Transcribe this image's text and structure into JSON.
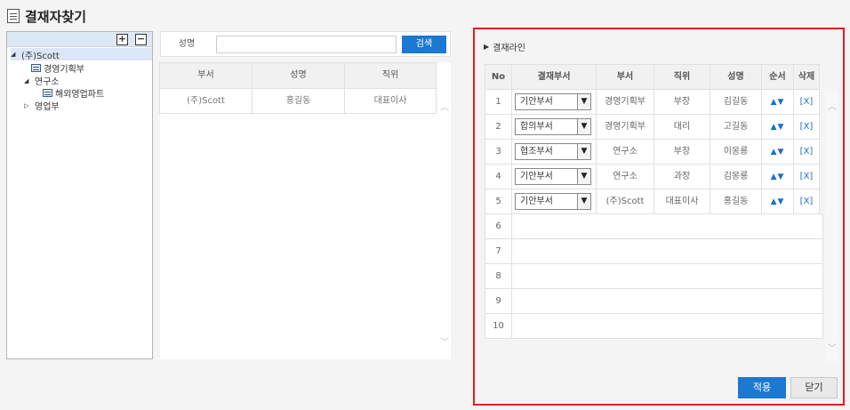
{
  "page_title": "결재자찾기",
  "tree": {
    "nodes": [
      {
        "label": "(주)Scott",
        "arrow": "◢"
      },
      {
        "label": "경영기획부"
      },
      {
        "label": "연구소",
        "arrow": "◢"
      },
      {
        "label": "해외영업파트"
      },
      {
        "label": "영업부",
        "arrow": "▷"
      }
    ]
  },
  "search": {
    "label": "성명",
    "value": "",
    "placeholder": "",
    "button": "검색"
  },
  "employees": {
    "columns": [
      "부서",
      "성명",
      "직위"
    ],
    "rows": [
      {
        "dept": "(주)Scott",
        "name": "홍길동",
        "position": "대표이사"
      }
    ]
  },
  "approval_line": {
    "title": "결재라인",
    "columns": [
      "No",
      "결재부서",
      "부서",
      "직위",
      "성명",
      "순서",
      "삭제"
    ],
    "rows": [
      {
        "no": "1",
        "type": "기안부서",
        "dept": "경영기획부",
        "position": "부장",
        "name": "김길동",
        "order": "▲▼",
        "delete": "[X]"
      },
      {
        "no": "2",
        "type": "합의부서",
        "dept": "경영기획부",
        "position": "대리",
        "name": "고길동",
        "order": "▲▼",
        "delete": "[X]"
      },
      {
        "no": "3",
        "type": "협조부서",
        "dept": "연구소",
        "position": "부장",
        "name": "이몽룡",
        "order": "▲▼",
        "delete": "[X]"
      },
      {
        "no": "4",
        "type": "기안부서",
        "dept": "연구소",
        "position": "과장",
        "name": "김몽룡",
        "order": "▲▼",
        "delete": "[X]"
      },
      {
        "no": "5",
        "type": "기안부서",
        "dept": "(주)Scott",
        "position": "대표이사",
        "name": "홍길동",
        "order": "▲▼",
        "delete": "[X]"
      }
    ],
    "empty_rows": [
      "6",
      "7",
      "8",
      "9",
      "10"
    ],
    "apply_button": "적용",
    "close_button": "닫기"
  },
  "colors": {
    "accent": "#1c78d0",
    "highlight_border": "#e02020"
  }
}
